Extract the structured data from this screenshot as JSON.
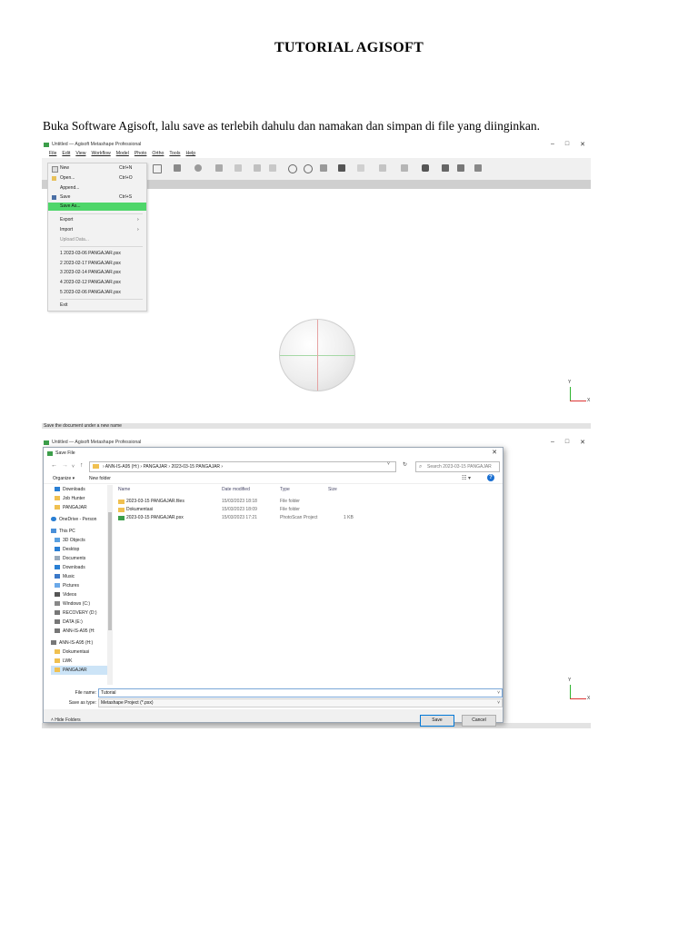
{
  "document": {
    "title": "TUTORIAL AGISOFT",
    "paragraph": "Buka Software Agisoft, lalu save as terlebih dahulu dan namakan dan simpan di file yang diinginkan."
  },
  "app": {
    "window_title": "Untitled — Agisoft Metashape Professional",
    "window_controls": [
      "–",
      "□",
      "✕"
    ],
    "menu": [
      "File",
      "Edit",
      "View",
      "Workflow",
      "Model",
      "Photo",
      "Ortho",
      "Tools",
      "Help"
    ],
    "axis_y": "Y",
    "axis_x": "X"
  },
  "file_menu": {
    "items": [
      {
        "label": "New",
        "shortcut": "Ctrl+N"
      },
      {
        "label": "Open...",
        "shortcut": "Ctrl+O"
      },
      {
        "label": "Append...",
        "shortcut": ""
      },
      {
        "label": "Save",
        "shortcut": "Ctrl+S"
      },
      {
        "label": "Save As...",
        "shortcut": "",
        "highlighted": true
      },
      {
        "label": "Export",
        "shortcut": "›"
      },
      {
        "label": "Import",
        "shortcut": "›"
      },
      {
        "label": "Upload Data...",
        "shortcut": "",
        "disabled": true
      },
      {
        "label": "1 2023-03-06 PANGAJAR.psx",
        "shortcut": ""
      },
      {
        "label": "2 2023-02-17 PANGAJAR.psx",
        "shortcut": ""
      },
      {
        "label": "3 2023-02-14 PANGAJAR.psx",
        "shortcut": ""
      },
      {
        "label": "4 2023-02-12 PANGAJAR.psx",
        "shortcut": ""
      },
      {
        "label": "5 2023-02-06 PANGAJAR.psx",
        "shortcut": ""
      },
      {
        "label": "Exit",
        "shortcut": ""
      }
    ],
    "highlight_color": "#4fd66a"
  },
  "status_bar": "Save the document under a new name",
  "save_dialog": {
    "title": "Save File",
    "close": "✕",
    "nav_back": "←",
    "nav_forward": "→",
    "nav_recent": "˅",
    "nav_up": "↑",
    "address_path": "›  ANN-IS-A95 (H:)  ›  PANGAJAR  ›  2023-03-15 PANGAJAR  ›",
    "address_dropdown": "˅",
    "refresh": "↻",
    "search_icon": "⌕",
    "search_placeholder": "Search 2023-03-15 PANGAJAR",
    "organize": "Organize ▾",
    "new_folder": "New folder",
    "view_toggle": "☷ ▾",
    "help": "?",
    "nav_items": [
      {
        "label": "Downloads",
        "icon": "download-icon"
      },
      {
        "label": "Job Hunter",
        "icon": "folder-icon"
      },
      {
        "label": "PANGAJAR",
        "icon": "folder-icon"
      },
      {
        "label": "OneDrive - Person",
        "icon": "cloud-icon"
      },
      {
        "label": "This PC",
        "icon": "pc-icon"
      },
      {
        "label": "3D Objects",
        "icon": "cube-icon"
      },
      {
        "label": "Desktop",
        "icon": "desktop-icon"
      },
      {
        "label": "Documents",
        "icon": "document-icon"
      },
      {
        "label": "Downloads",
        "icon": "download-icon"
      },
      {
        "label": "Music",
        "icon": "music-icon"
      },
      {
        "label": "Pictures",
        "icon": "picture-icon"
      },
      {
        "label": "Videos",
        "icon": "video-icon"
      },
      {
        "label": "Windows (C:)",
        "icon": "drive-icon"
      },
      {
        "label": "RECOVERY (D:)",
        "icon": "drive-icon"
      },
      {
        "label": "DATA (E:)",
        "icon": "drive-icon"
      },
      {
        "label": "ANN-IS-A95 (H:",
        "icon": "drive-icon"
      },
      {
        "label": "ANN-IS-A95 (H:)",
        "icon": "drive-icon"
      },
      {
        "label": "Dokumentasi",
        "icon": "folder-icon"
      },
      {
        "label": "LWK",
        "icon": "folder-icon"
      },
      {
        "label": "PANGAJAR",
        "icon": "folder-icon",
        "selected": true
      }
    ],
    "columns": [
      "Name",
      "Date modified",
      "Type",
      "Size"
    ],
    "files": [
      {
        "name": "2023-03-15 PANGAJAR.files",
        "date": "15/03/2023 18:18",
        "type": "File folder",
        "size": ""
      },
      {
        "name": "Dokumentasi",
        "date": "15/03/2023 18:09",
        "type": "File folder",
        "size": ""
      },
      {
        "name": "2023-03-15 PANGAJAR.psx",
        "date": "15/03/2023 17:21",
        "type": "PhotoScan Project",
        "size": "1 KB"
      }
    ],
    "file_name_label": "File name:",
    "file_name_value": "Tutorial",
    "save_type_label": "Save as type:",
    "save_type_value": "Metashape Project (*.psx)",
    "dropdown_glyph": "˅",
    "hide_folders": "˄  Hide Folders",
    "save_button": "Save",
    "cancel_button": "Cancel"
  }
}
